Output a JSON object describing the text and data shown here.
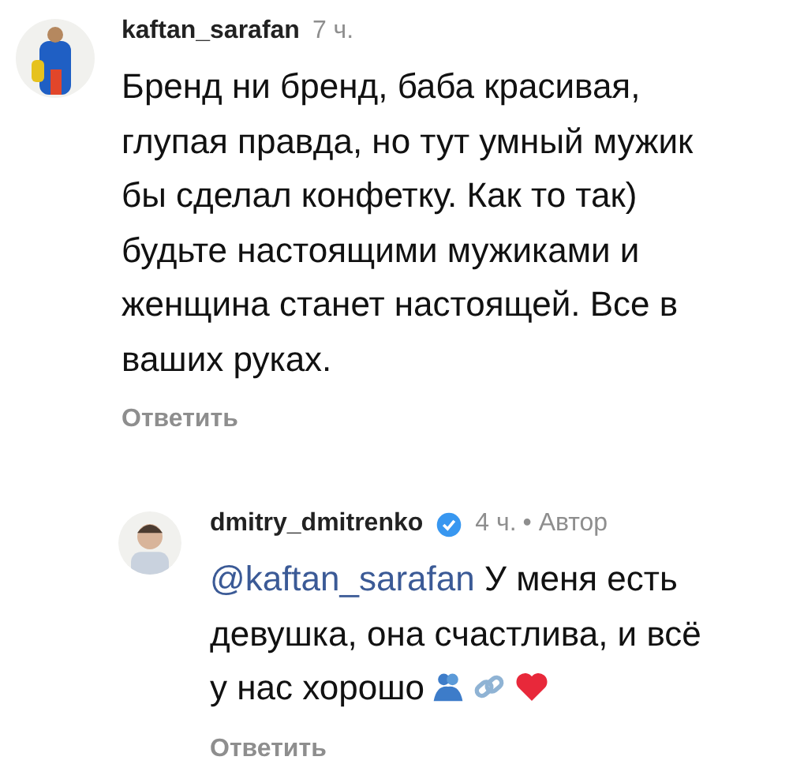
{
  "comments": [
    {
      "username": "kaftan_sarafan",
      "verified": false,
      "time": "7 ч.",
      "text": "Бренд ни бренд, баба красивая, глупая правда, но тут умный мужик бы сделал конфетку. Как то так) будьте настоящими мужиками и женщина станет настоящей. Все в ваших руках.",
      "reply": "Ответить",
      "kind": "top"
    },
    {
      "username": "dmitry_dmitrenko",
      "verified": true,
      "time": "4 ч.",
      "author_tag": "• Автор",
      "mention": "@kaftan_sarafan",
      "text": "У меня есть девушка, она счастлива, и всё у нас хорошо",
      "reply": "Ответить",
      "kind": "reply"
    }
  ]
}
